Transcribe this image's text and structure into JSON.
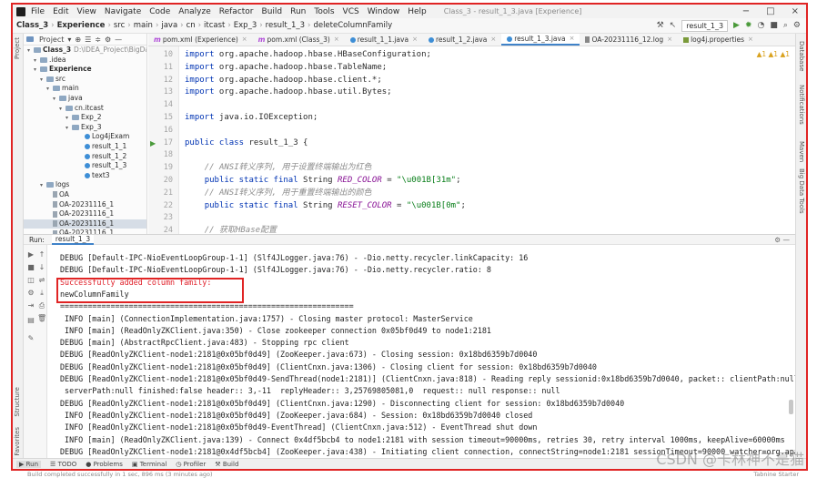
{
  "menubar": {
    "items": [
      "File",
      "Edit",
      "View",
      "Navigate",
      "Code",
      "Analyze",
      "Refactor",
      "Build",
      "Run",
      "Tools",
      "VCS",
      "Window",
      "Help"
    ],
    "window_title": "Class_3 - result_1_3.java [Experience]",
    "controls": [
      "−",
      "□",
      "×"
    ]
  },
  "navbar": {
    "crumbs": [
      "Class_3",
      "Experience",
      "src",
      "main",
      "java",
      "cn",
      "itcast",
      "Exp_3",
      "result_1_3",
      "deleteColumnFamily"
    ],
    "run_config": "result_1_3"
  },
  "stripes": {
    "left": [
      "Project",
      "Structure",
      "Favorites"
    ],
    "right": [
      "Database",
      "Notifications",
      "Maven",
      "Big Data Tools"
    ]
  },
  "project": {
    "header": "Project",
    "tree": [
      {
        "label": "Class_3",
        "extra": "D:\\IDEA_Project\\BigData",
        "indent": 0,
        "type": "folder",
        "bold": true
      },
      {
        "label": ".idea",
        "indent": 1,
        "type": "folder"
      },
      {
        "label": "Experience",
        "indent": 1,
        "type": "folder",
        "bold": true
      },
      {
        "label": "src",
        "indent": 2,
        "type": "folder"
      },
      {
        "label": "main",
        "indent": 3,
        "type": "folder"
      },
      {
        "label": "java",
        "indent": 4,
        "type": "folder"
      },
      {
        "label": "cn.itcast",
        "indent": 5,
        "type": "folder"
      },
      {
        "label": "Exp_2",
        "indent": 6,
        "type": "folder"
      },
      {
        "label": "Exp_3",
        "indent": 6,
        "type": "folder"
      },
      {
        "label": "Log4jExam",
        "indent": 8,
        "type": "java"
      },
      {
        "label": "result_1_1",
        "indent": 8,
        "type": "java"
      },
      {
        "label": "result_1_2",
        "indent": 8,
        "type": "java"
      },
      {
        "label": "result_1_3",
        "indent": 8,
        "type": "java"
      },
      {
        "label": "text3",
        "indent": 8,
        "type": "java"
      },
      {
        "label": "logs",
        "indent": 2,
        "type": "folder"
      },
      {
        "label": "OA",
        "indent": 3,
        "type": "file"
      },
      {
        "label": "OA-20231116_1",
        "indent": 3,
        "type": "file"
      },
      {
        "label": "OA-20231116_1",
        "indent": 3,
        "type": "file"
      },
      {
        "label": "OA-20231116_1",
        "indent": 3,
        "type": "file",
        "selected": true
      },
      {
        "label": "OA-20231116_1",
        "indent": 3,
        "type": "file"
      }
    ]
  },
  "tabs": [
    {
      "label": "pom.xml (Experience)",
      "icon": "m"
    },
    {
      "label": "pom.xml (Class_3)",
      "icon": "m"
    },
    {
      "label": "result_1_1.java",
      "icon": "c"
    },
    {
      "label": "result_1_2.java",
      "icon": "c"
    },
    {
      "label": "result_1_3.java",
      "icon": "c",
      "active": true
    },
    {
      "label": "OA-20231116_12.log",
      "icon": "log"
    },
    {
      "label": "log4j.properties",
      "icon": "prop"
    }
  ],
  "editor": {
    "warnings": "▲1 ▲1 ▲1",
    "lines": [
      {
        "n": "10",
        "html": "<span class=\"kw\">import</span> org.apache.hadoop.hbase.HBaseConfiguration;"
      },
      {
        "n": "11",
        "html": "<span class=\"kw\">import</span> org.apache.hadoop.hbase.TableName;"
      },
      {
        "n": "12",
        "html": "<span class=\"kw\">import</span> org.apache.hadoop.hbase.client.*;"
      },
      {
        "n": "13",
        "html": "<span class=\"kw\">import</span> org.apache.hadoop.hbase.util.Bytes;"
      },
      {
        "n": "14",
        "html": ""
      },
      {
        "n": "15",
        "html": "<span class=\"kw\">import</span> java.io.IOException;"
      },
      {
        "n": "16",
        "html": ""
      },
      {
        "n": "17",
        "html": "<span class=\"kw\">public class</span> result_1_3 {"
      },
      {
        "n": "18",
        "html": ""
      },
      {
        "n": "19",
        "html": "    <span class=\"cm\">// ANSI转义序列, 用于设置终端输出为红色</span>"
      },
      {
        "n": "20",
        "html": "    <span class=\"kw\">public static final</span> String <span class=\"const\">RED_COLOR</span> = <span class=\"str\">\"\\u001B[31m\"</span>;"
      },
      {
        "n": "21",
        "html": "    <span class=\"cm\">// ANSI转义序列, 用于重置终端输出的颜色</span>"
      },
      {
        "n": "22",
        "html": "    <span class=\"kw\">public static final</span> String <span class=\"const\">RESET_COLOR</span> = <span class=\"str\">\"\\u001B[0m\"</span>;"
      },
      {
        "n": "23",
        "html": ""
      },
      {
        "n": "24",
        "html": "    <span class=\"cm\">// 获取HBase配置</span>"
      }
    ]
  },
  "run_panel": {
    "label": "Run:",
    "tab": "result_1_3",
    "console": [
      {
        "text": "DEBUG [Default-IPC-NioEventLoopGroup-1-1] (Slf4JLogger.java:76) - -Dio.netty.recycler.linkCapacity: 16"
      },
      {
        "text": "DEBUG [Default-IPC-NioEventLoopGroup-1-1] (Slf4JLogger.java:76) - -Dio.netty.recycler.ratio: 8"
      },
      {
        "text": "Successfully added column family:",
        "red": true
      },
      {
        "text": "newColumnFamily"
      },
      {
        "text": "================================================================"
      },
      {
        "text": " INFO [main] (ConnectionImplementation.java:1757) - Closing master protocol: MasterService"
      },
      {
        "text": " INFO [main] (ReadOnlyZKClient.java:350) - Close zookeeper connection 0x05bf0d49 to node1:2181"
      },
      {
        "text": "DEBUG [main] (AbstractRpcClient.java:483) - Stopping rpc client"
      },
      {
        "text": "DEBUG [ReadOnlyZKClient-node1:2181@0x05bf0d49] (ZooKeeper.java:673) - Closing session: 0x18bd6359b7d0040"
      },
      {
        "text": "DEBUG [ReadOnlyZKClient-node1:2181@0x05bf0d49] (ClientCnxn.java:1306) - Closing client for session: 0x18bd6359b7d0040"
      },
      {
        "text": "DEBUG [ReadOnlyZKClient-node1:2181@0x05bf0d49-SendThread(node1:2181)] (ClientCnxn.java:818) - Reading reply sessionid:0x18bd6359b7d0040, packet:: clientPath:null"
      },
      {
        "text": " serverPath:null finished:false header:: 3,-11  replyHeader:: 3,25769805081,0  request:: null response:: null"
      },
      {
        "text": "DEBUG [ReadOnlyZKClient-node1:2181@0x05bf0d49] (ClientCnxn.java:1290) - Disconnecting client for session: 0x18bd6359b7d0040"
      },
      {
        "text": " INFO [ReadOnlyZKClient-node1:2181@0x05bf0d49] (ZooKeeper.java:684) - Session: 0x18bd6359b7d0040 closed"
      },
      {
        "text": " INFO [ReadOnlyZKClient-node1:2181@0x05bf0d49-EventThread] (ClientCnxn.java:512) - EventThread shut down"
      },
      {
        "text": " INFO [main] (ReadOnlyZKClient.java:139) - Connect 0x4df5bcb4 to node1:2181 with session timeout=90000ms, retries 30, retry interval 1000ms, keepAlive=60000ms"
      },
      {
        "text": "DEBUG [ReadOnlyZKClient-node1:2181@0x4df5bcb4] (ZooKeeper.java:438) - Initiating client connection, connectString=node1:2181 sessionTimeout=90000 watcher=org.apache"
      }
    ]
  },
  "bottom_tools": [
    "Run",
    "TODO",
    "Problems",
    "Terminal",
    "Profiler",
    "Build"
  ],
  "status": {
    "left": "Build completed successfully in 1 sec, 896 ms (3 minutes ago)",
    "right": "Tabnine Starter"
  },
  "watermark": "CSDN @卡林神不是猫",
  "colors": {
    "accent": "#4083c9",
    "highlight": "#e02424",
    "keyword": "#0033b3"
  }
}
